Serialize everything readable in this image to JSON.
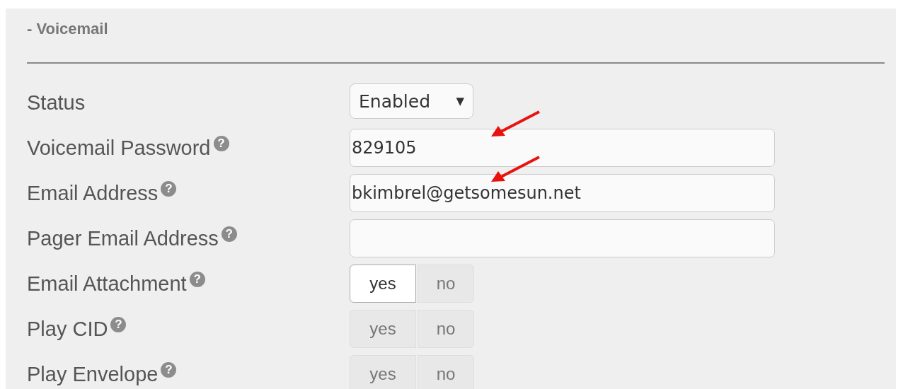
{
  "section": {
    "title": "- Voicemail"
  },
  "rows": [
    {
      "kind": "select",
      "label": "Status",
      "value": "Enabled",
      "caret": "▼"
    },
    {
      "kind": "text",
      "label": "Voicemail Password",
      "help": "?",
      "value": "829105",
      "annotated": true
    },
    {
      "kind": "text",
      "label": "Email Address",
      "help": "?",
      "value": "bkimbrel@getsomesun.net",
      "annotated": true
    },
    {
      "kind": "text",
      "label": "Pager Email Address",
      "help": "?",
      "value": ""
    },
    {
      "kind": "toggle",
      "label": "Email Attachment",
      "help": "?",
      "options": [
        {
          "label": "yes",
          "selected": true
        },
        {
          "label": "no",
          "selected": false
        }
      ]
    },
    {
      "kind": "toggle",
      "label": "Play CID",
      "help": "?",
      "options": [
        {
          "label": "yes",
          "selected": false
        },
        {
          "label": "no",
          "selected": false
        }
      ]
    },
    {
      "kind": "toggle",
      "label": "Play Envelope",
      "help": "?",
      "options": [
        {
          "label": "yes",
          "selected": false
        },
        {
          "label": "no",
          "selected": false
        }
      ]
    }
  ]
}
